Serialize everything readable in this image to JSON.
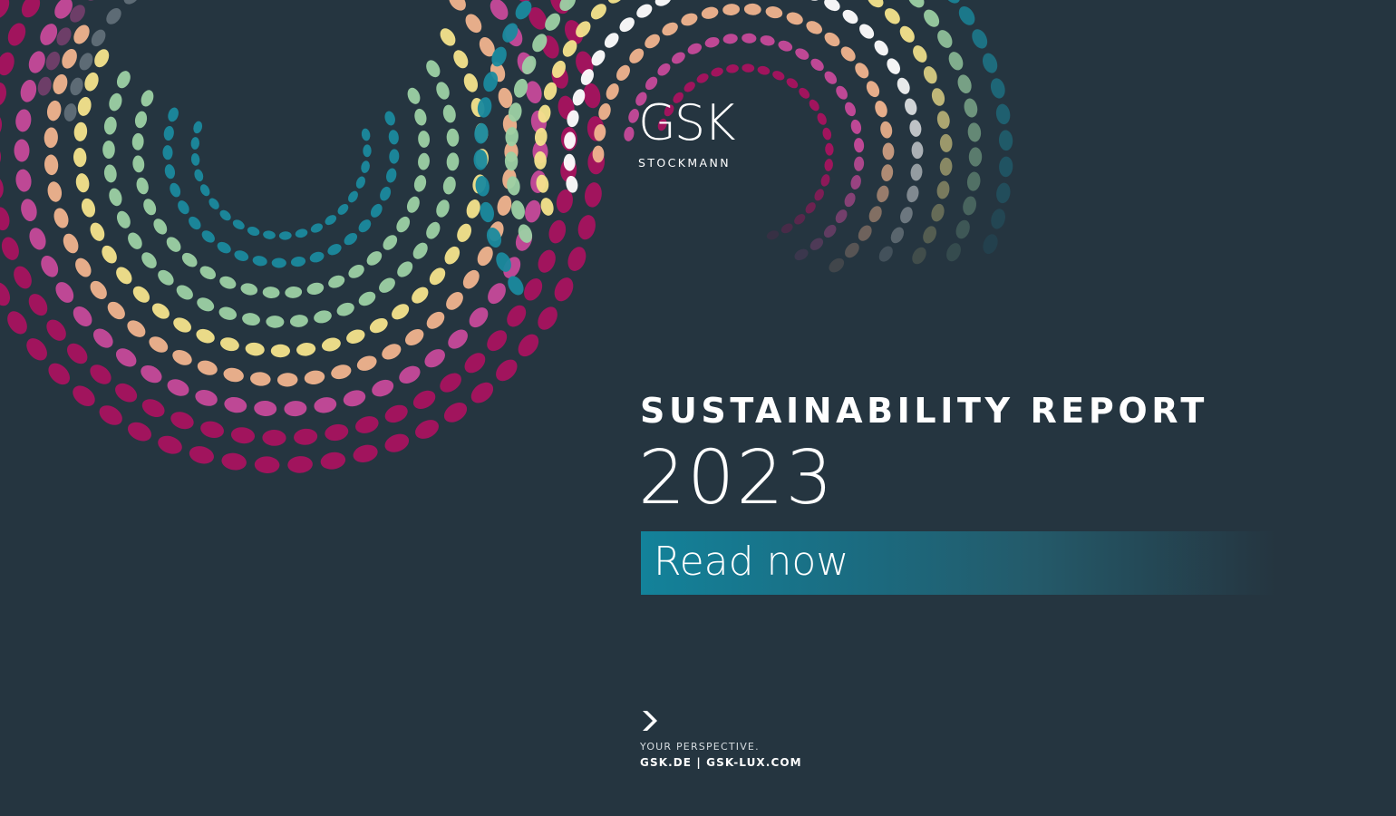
{
  "logo": {
    "word": "GSK",
    "subtitle": "STOCKMANN"
  },
  "heading": {
    "title": "SUSTAINABILITY REPORT",
    "year": "2023"
  },
  "cta": {
    "label": "Read now"
  },
  "footer": {
    "tagline": "YOUR PERSPECTIVE.",
    "links": "GSK.DE | GSK-LUX.COM",
    "icon": "chevron-right-icon"
  },
  "colors": {
    "background": "#253540",
    "teal": "#1a8a9e",
    "magenta": "#a8135f",
    "pink": "#c64a9a",
    "peach": "#f0b48e",
    "yellow": "#f4e48c",
    "mint": "#9cd1a4",
    "grey": "#8c97a0",
    "white": "#ffffff"
  }
}
